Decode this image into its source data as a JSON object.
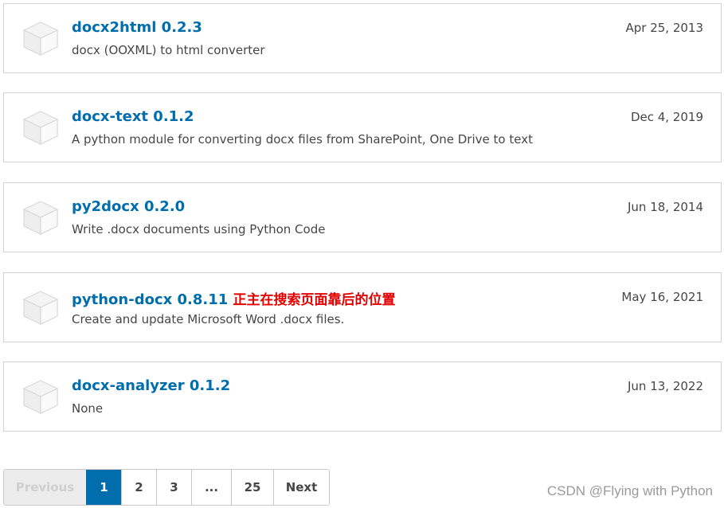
{
  "packages": [
    {
      "name": "docx2html 0.2.3",
      "note": "",
      "description": "docx (OOXML) to html converter",
      "date": "Apr 25, 2013",
      "icon": "package-box-icon"
    },
    {
      "name": "docx-text 0.1.2",
      "note": "",
      "description": "A python module for converting docx files from SharePoint, One Drive to text",
      "date": "Dec 4, 2019",
      "icon": "package-box-icon"
    },
    {
      "name": "py2docx 0.2.0",
      "note": "",
      "description": "Write .docx documents using Python Code",
      "date": "Jun 18, 2014",
      "icon": "package-box-icon"
    },
    {
      "name": "python-docx 0.8.11",
      "note": "正主在搜索页面靠后的位置",
      "description": "Create and update Microsoft Word .docx files.",
      "date": "May 16, 2021",
      "icon": "package-box-icon"
    },
    {
      "name": "docx-analyzer 0.1.2",
      "note": "",
      "description": "None",
      "date": "Jun 13, 2022",
      "icon": "package-box-icon"
    }
  ],
  "pagination": {
    "previous": "Previous",
    "pages": [
      "1",
      "2",
      "3",
      "...",
      "25"
    ],
    "current": "1",
    "next": "Next"
  },
  "watermark": "CSDN @Flying with Python",
  "colors": {
    "link": "#006dad",
    "note": "#e00000",
    "active_page": "#006dad"
  }
}
